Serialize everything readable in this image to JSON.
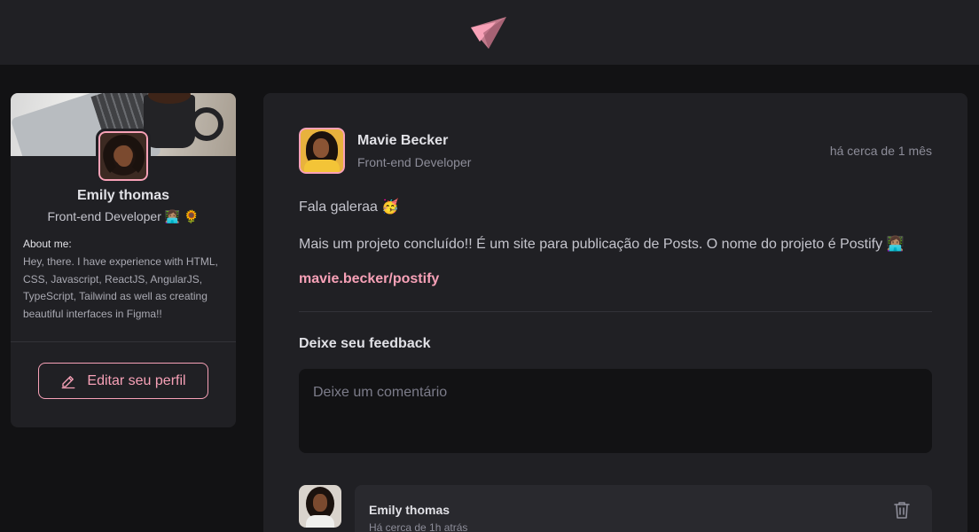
{
  "header": {
    "logo_icon": "ignite-feed-logo-icon"
  },
  "sidebar": {
    "cover_image": "desk-laptop-coffee-cover",
    "name": "Emily thomas",
    "role": "Front-end Developer 👩🏽‍💻 🌻",
    "about_title": "About me:",
    "about_text": "Hey, there. I have experience with HTML, CSS, Javascript, ReactJS, AngularJS, TypeScript, Tailwind as well as creating beautiful interfaces in Figma!!",
    "edit_button_label": "Editar seu perfil",
    "edit_icon": "pencil-icon"
  },
  "post": {
    "author_name": "Mavie Becker",
    "author_role": "Front-end Developer",
    "time": "há cerca de 1 mês",
    "paragraphs": [
      "Fala galeraa 🥳",
      "Mais um projeto concluído!! É um site para publicação de Posts. O nome do projeto é Postify 👩🏽‍💻"
    ],
    "link_text": "mavie.becker/postify",
    "feedback_title": "Deixe seu feedback",
    "comment_placeholder": "Deixe um comentário",
    "comment_value": ""
  },
  "comments": [
    {
      "author": "Emily thomas",
      "time": "Há cerca de 1h atrás",
      "delete_icon": "trash-icon"
    }
  ],
  "colors": {
    "background": "#121214",
    "surface": "#202024",
    "accent": "#f7a1b7",
    "text": "#c4c4cc",
    "heading": "#e1e1e6",
    "muted": "#8d8d99"
  }
}
